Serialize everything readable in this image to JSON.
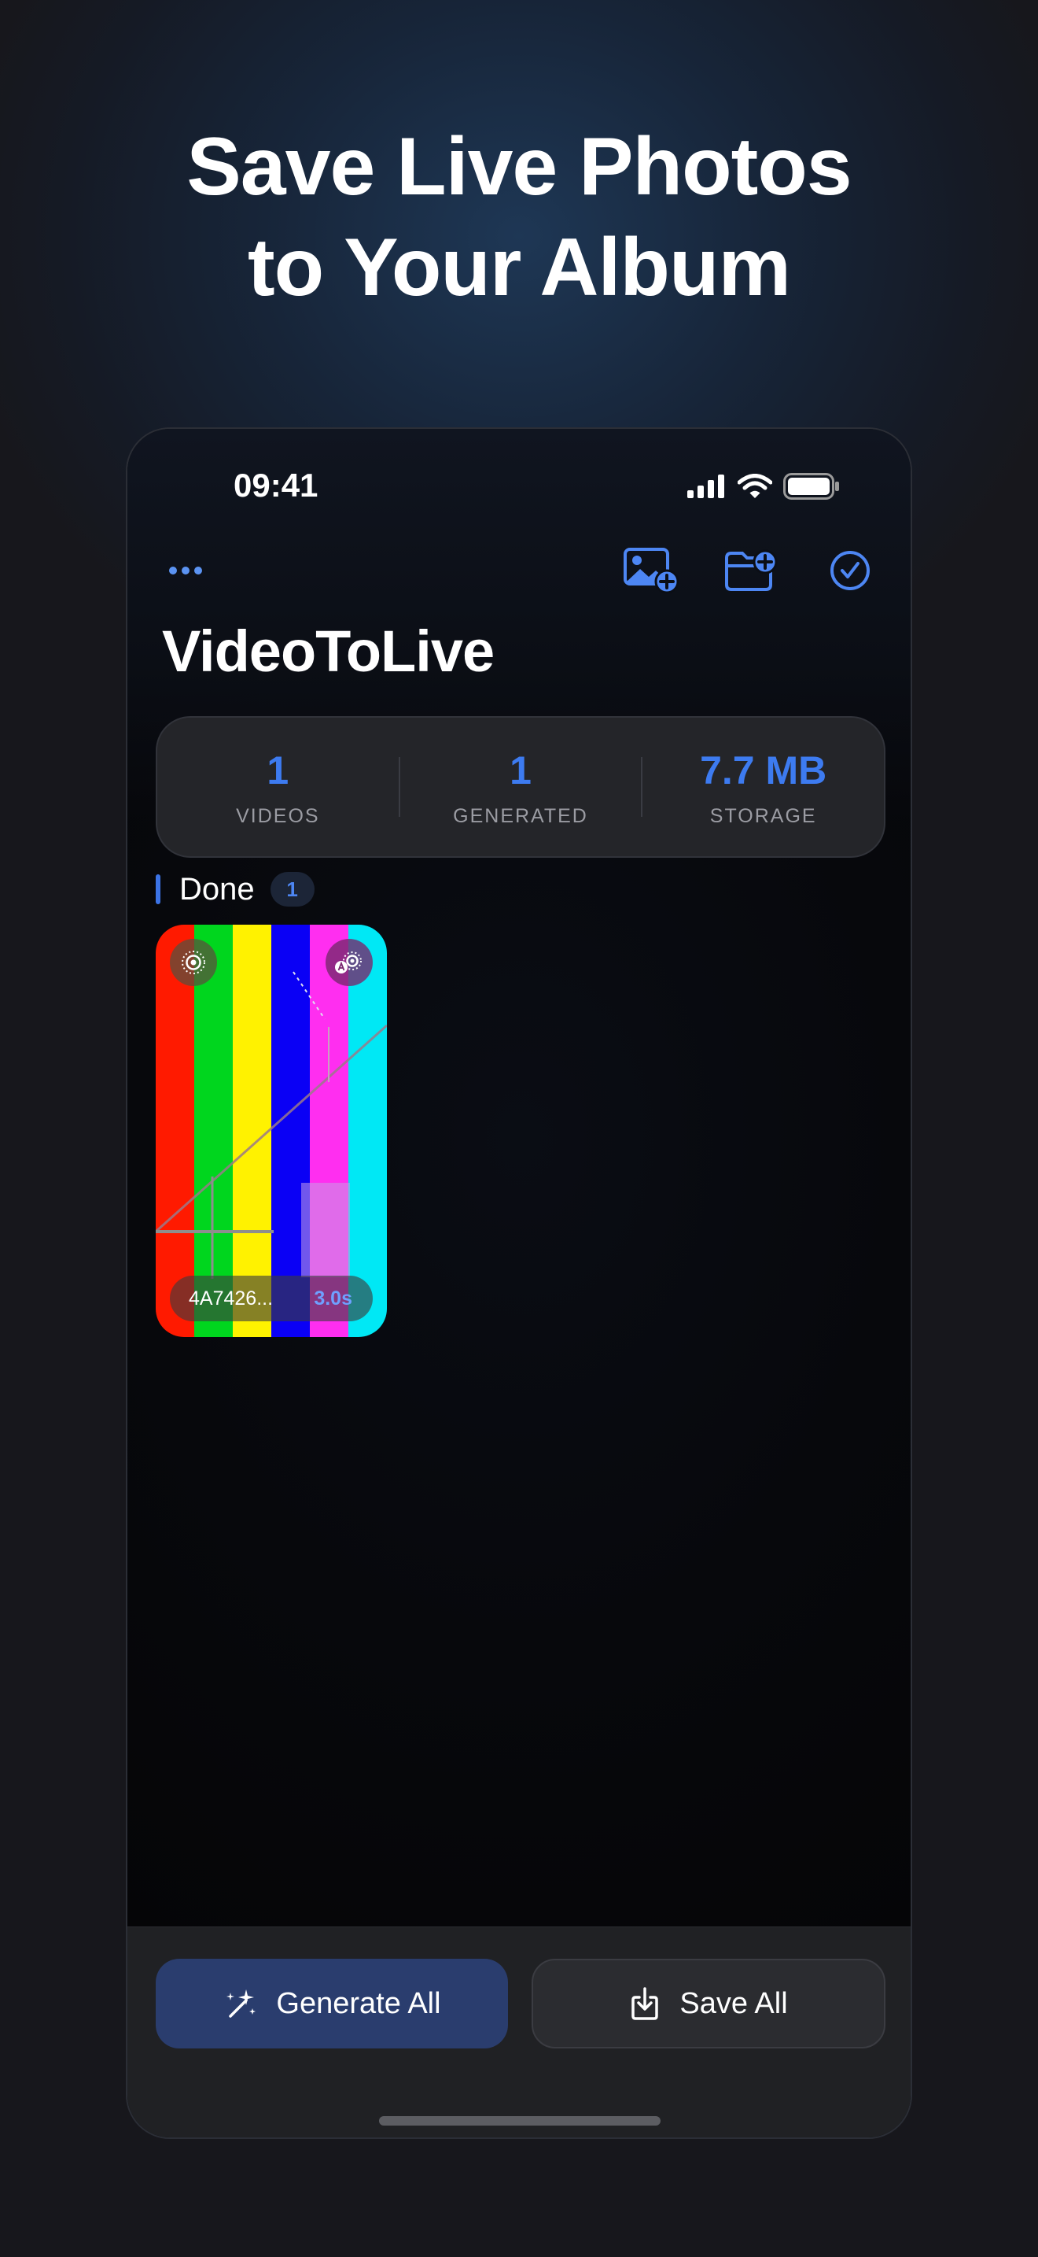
{
  "headline": {
    "line1": "Save Live Photos",
    "line2": "to Your Album"
  },
  "status_bar": {
    "time": "09:41"
  },
  "nav": {
    "more_icon": "ellipsis-icon",
    "icons": [
      "add-photo-icon",
      "add-folder-icon",
      "select-checkmark-icon"
    ]
  },
  "app": {
    "title": "VideoToLive"
  },
  "stats": [
    {
      "value": "1",
      "label": "VIDEOS"
    },
    {
      "value": "1",
      "label": "GENERATED"
    },
    {
      "value": "7.7 MB",
      "label": "STORAGE"
    }
  ],
  "section": {
    "title": "Done",
    "count": "1"
  },
  "items": [
    {
      "name": "4A7426...",
      "duration": "3.0s"
    }
  ],
  "buttons": {
    "generate_all": "Generate All",
    "save_all": "Save All"
  },
  "colors": {
    "accent": "#3d7bf0",
    "generate_bg": "#2a3d6e",
    "panel": "#242529"
  }
}
